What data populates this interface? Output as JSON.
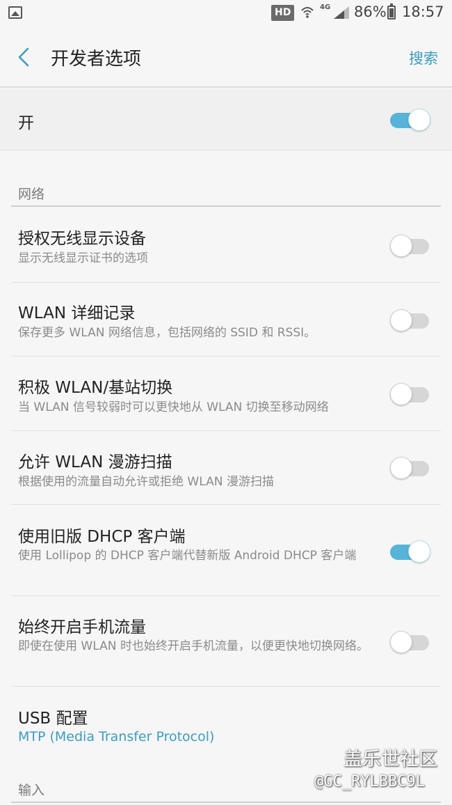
{
  "status_bar": {
    "gallery_icon": "image-icon",
    "hd_label": "HD",
    "network_label": "4G",
    "battery_percent": "86%",
    "time": "18:57"
  },
  "header": {
    "title": "开发者选项",
    "search_label": "搜索"
  },
  "master": {
    "label": "开",
    "on": true
  },
  "sections": {
    "network": "网络",
    "input": "输入"
  },
  "settings": [
    {
      "title": "授权无线显示设备",
      "subtitle": "显示无线显示证书的选项",
      "on": false
    },
    {
      "title": "WLAN 详细记录",
      "subtitle": "保存更多 WLAN 网络信息，包括网络的 SSID 和 RSSI。",
      "on": false
    },
    {
      "title": "积极 WLAN/基站切换",
      "subtitle": "当 WLAN 信号较弱时可以更快地从 WLAN 切换至移动网络",
      "on": false
    },
    {
      "title": "允许 WLAN 漫游扫描",
      "subtitle": "根据使用的流量自动允许或拒绝 WLAN 漫游扫描",
      "on": false
    },
    {
      "title": "使用旧版 DHCP 客户端",
      "subtitle": "使用 Lollipop 的 DHCP 客户端代替新版 Android DHCP 客户端",
      "on": true
    },
    {
      "title": "始终开启手机流量",
      "subtitle": "即使在使用 WLAN 时也始终开启手机流量，以便更快地切换网络。",
      "on": false
    },
    {
      "title": "USB 配置",
      "subtitle": "MTP (Media Transfer Protocol)"
    }
  ],
  "watermark": {
    "line1": "盖乐世社区",
    "line2": "@GC_RYLBBC9L"
  },
  "colors": {
    "accent": "#3e9bbd",
    "toggle_on": "#57b4d8",
    "toggle_off": "#d6d6d6"
  }
}
